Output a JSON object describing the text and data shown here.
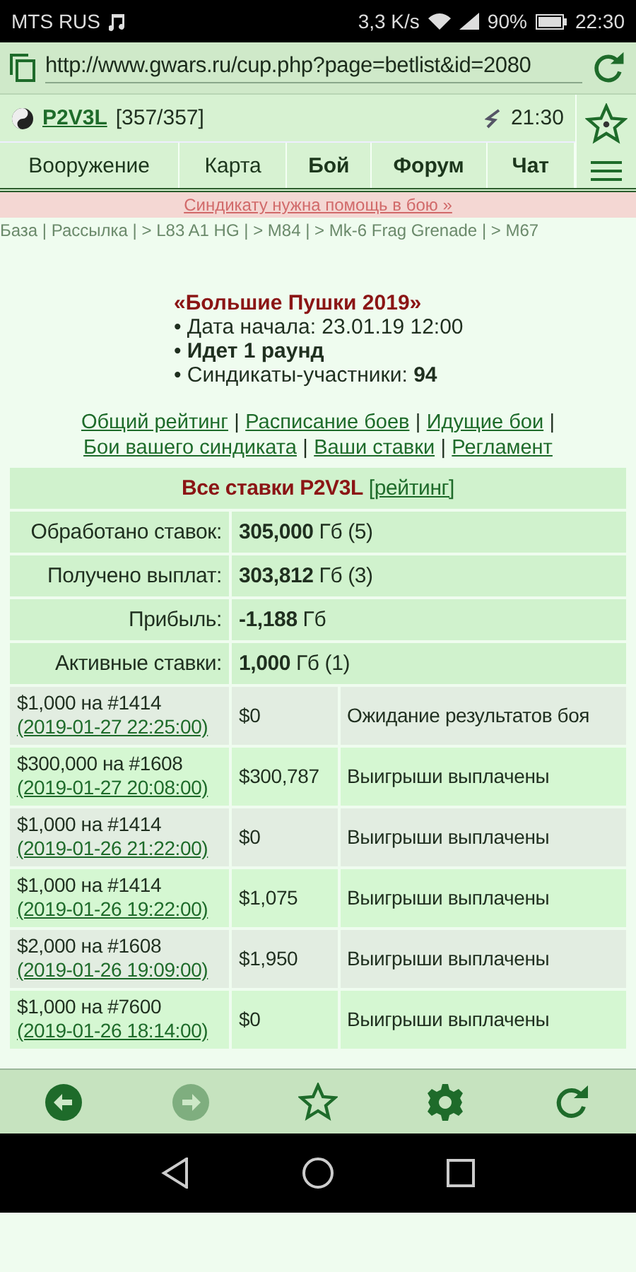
{
  "status_bar": {
    "carrier": "MTS RUS",
    "speed": "3,3 K/s",
    "battery": "90%",
    "time": "22:30"
  },
  "address_bar": {
    "url": "http://www.gwars.ru/cup.php?page=betlist&id=2080"
  },
  "user_bar": {
    "name": "P2V3L",
    "hp": "[357/357]",
    "time": "21:30"
  },
  "nav": [
    {
      "label": "Вооружение",
      "bold": false
    },
    {
      "label": "Карта",
      "bold": false
    },
    {
      "label": "Бой",
      "bold": true
    },
    {
      "label": "Форум",
      "bold": true
    },
    {
      "label": "Чат",
      "bold": true
    }
  ],
  "alert": "Синдикату нужна помощь в бою »",
  "breadcrumbs": "База | Рассылка | > L83 A1 HG | > M84 | > Mk-6 Frag Grenade | > M67",
  "tournament": {
    "title": "«Большие Пушки 2019»",
    "facts": [
      "• Дата начала: 23.01.19 12:00",
      "• **Идет 1 раунд**",
      "• Синдикаты-участники: **94**"
    ]
  },
  "links": [
    {
      "label": "Общий рейтинг"
    },
    {
      "label": "Расписание боев"
    },
    {
      "label": "Идущие бои"
    },
    {
      "label": "Бои вашего синдиката"
    },
    {
      "label": "Ваши ставки"
    },
    {
      "label": "Регламент"
    }
  ],
  "link_separator": "|",
  "summary": {
    "title": "Все ставки P2V3L",
    "title_link": "[рейтинг]",
    "rows": [
      {
        "label": "Обработано ставок:",
        "value": "**305,000** Гб (5)"
      },
      {
        "label": "Получено выплат:",
        "value": "**303,812** Гб (3)"
      },
      {
        "label": "Прибыль:",
        "value": "**-1,188** Гб"
      },
      {
        "label": "Активные ставки:",
        "value": "**1,000** Гб (1)"
      }
    ]
  },
  "bets": [
    {
      "stake": "$1,000 на #1414",
      "time": "(2019-01-27 22:25:00)",
      "payout": "$0",
      "status": "Ожидание результатов боя"
    },
    {
      "stake": "$300,000 на #1608",
      "time": "(2019-01-27 20:08:00)",
      "payout": "$300,787",
      "status": "Выигрыши выплачены"
    },
    {
      "stake": "$1,000 на #1414",
      "time": "(2019-01-26 21:22:00)",
      "payout": "$0",
      "status": "Выигрыши выплачены"
    },
    {
      "stake": "$1,000 на #1414",
      "time": "(2019-01-26 19:22:00)",
      "payout": "$1,075",
      "status": "Выигрыши выплачены"
    },
    {
      "stake": "$2,000 на #1608",
      "time": "(2019-01-26 19:09:00)",
      "payout": "$1,950",
      "status": "Выигрыши выплачены"
    },
    {
      "stake": "$1,000 на #7600",
      "time": "(2019-01-26 18:14:00)",
      "payout": "$0",
      "status": "Выигрыши выплачены"
    }
  ],
  "toolbar": [
    {
      "kind": "back",
      "disabled": false
    },
    {
      "kind": "forward",
      "disabled": true
    },
    {
      "kind": "star",
      "disabled": false
    },
    {
      "kind": "settings",
      "disabled": false
    },
    {
      "kind": "reload",
      "disabled": false
    }
  ]
}
